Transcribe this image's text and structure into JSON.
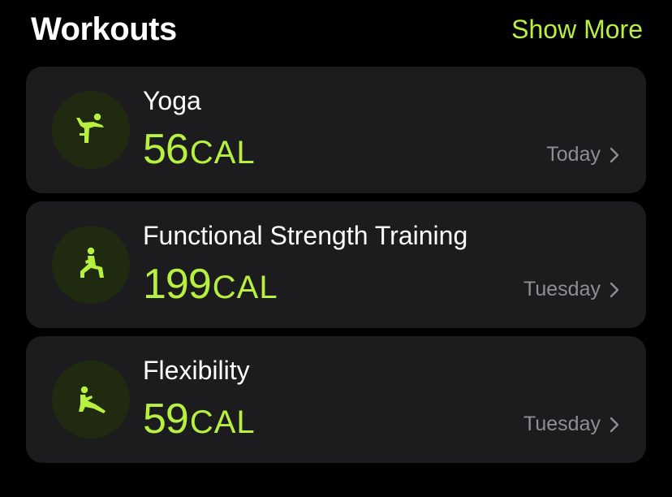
{
  "header": {
    "title": "Workouts",
    "show_more_label": "Show More"
  },
  "workouts": [
    {
      "name": "Yoga",
      "calories_value": "56",
      "calories_unit": "CAL",
      "date": "Today",
      "icon": "yoga-icon"
    },
    {
      "name": "Functional Strength Training",
      "calories_value": "199",
      "calories_unit": "CAL",
      "date": "Tuesday",
      "icon": "functional-strength-icon"
    },
    {
      "name": "Flexibility",
      "calories_value": "59",
      "calories_unit": "CAL",
      "date": "Tuesday",
      "icon": "flexibility-icon"
    }
  ],
  "colors": {
    "accent": "#b7f03f",
    "card_background": "#1c1c1e",
    "icon_background": "#1f2a10",
    "secondary_text": "#8e8e93"
  }
}
